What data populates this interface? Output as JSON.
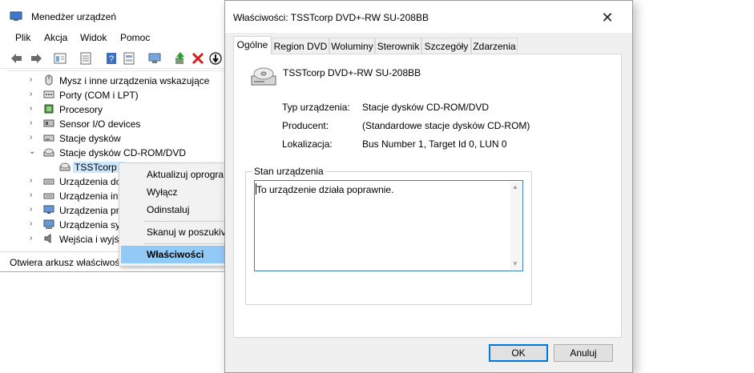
{
  "device_manager": {
    "title": "Menedżer urządzeń",
    "menu": [
      "Plik",
      "Akcja",
      "Widok",
      "Pomoc"
    ],
    "toolbar_icons": [
      "back-arrow-icon",
      "forward-arrow-icon",
      "properties-pane-icon",
      "list-view-icon",
      "help-icon",
      "show-hidden-icon",
      "scan-hardware-icon",
      "update-driver-icon",
      "uninstall-x-icon",
      "disable-device-icon"
    ],
    "tree": [
      {
        "label": "Mysz i inne urządzenia wskazujące",
        "icon": "mouse-icon",
        "expanded": false
      },
      {
        "label": "Porty (COM i LPT)",
        "icon": "port-icon",
        "expanded": false
      },
      {
        "label": "Procesory",
        "icon": "processor-icon",
        "expanded": false
      },
      {
        "label": "Sensor I/O devices",
        "icon": "sensor-icon",
        "expanded": false
      },
      {
        "label": "Stacje dysków",
        "icon": "disk-drive-icon",
        "expanded": false
      },
      {
        "label": "Stacje dysków CD-ROM/DVD",
        "icon": "cdrom-icon",
        "expanded": true
      },
      {
        "label": "TSSTcorp I",
        "icon": "cdrom-icon",
        "child": true,
        "selected": true
      },
      {
        "label": "Urządzenia do",
        "icon": "hid-icon",
        "expanded": false
      },
      {
        "label": "Urządzenia int",
        "icon": "hid-icon",
        "expanded": false
      },
      {
        "label": "Urządzenia pro",
        "icon": "monitor-icon",
        "expanded": false
      },
      {
        "label": "Urządzenia sys",
        "icon": "system-icon",
        "expanded": false
      },
      {
        "label": "Wejścia i wyjś",
        "icon": "speaker-icon",
        "expanded": false
      }
    ],
    "status": "Otwiera arkusz właściwoś"
  },
  "context_menu": {
    "items": [
      {
        "label": "Aktualizuj oprogra"
      },
      {
        "label": "Wyłącz"
      },
      {
        "label": "Odinstaluj"
      },
      {
        "label": "Skanuj w poszukiv"
      },
      {
        "label": "Właściwości",
        "highlighted": true
      }
    ]
  },
  "dialog": {
    "title": "Właściwości: TSSTcorp DVD+-RW SU-208BB",
    "close_glyph": "✕",
    "tabs": [
      {
        "label": "Ogólne",
        "active": true
      },
      {
        "label": "Region DVD"
      },
      {
        "label": "Woluminy"
      },
      {
        "label": "Sterownik"
      },
      {
        "label": "Szczegóły"
      },
      {
        "label": "Zdarzenia"
      }
    ],
    "device_name": "TSSTcorp DVD+-RW SU-208BB",
    "properties": [
      {
        "label": "Typ urządzenia:",
        "value": "Stacje dysków CD-ROM/DVD"
      },
      {
        "label": "Producent:",
        "value": "(Standardowe stacje dysków CD-ROM)"
      },
      {
        "label": "Lokalizacja:",
        "value": "Bus Number 1, Target Id 0, LUN 0"
      }
    ],
    "status_group_label": "Stan urządzenia",
    "status_text": "To urządzenie działa poprawnie.",
    "ok_label": "OK",
    "cancel_label": "Anuluj"
  }
}
